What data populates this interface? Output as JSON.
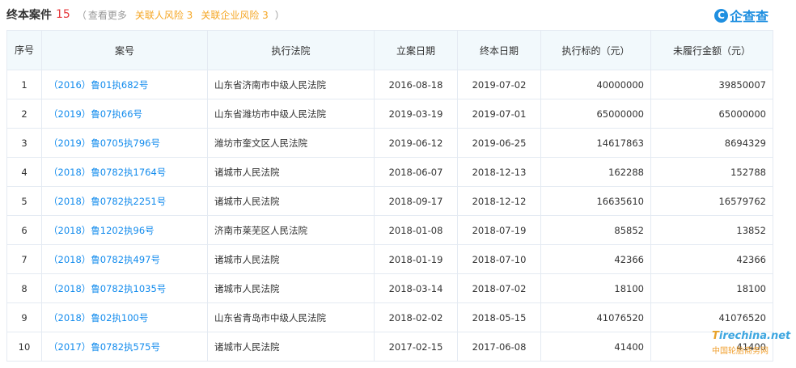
{
  "header": {
    "title": "终本案件",
    "count": "15",
    "paren_open": "（",
    "view_more": "查看更多",
    "related_person_risk": "关联人风险 3",
    "related_company_risk": "关联企业风险 3",
    "paren_close": "）"
  },
  "logo": {
    "mark": "C",
    "text": "企查查"
  },
  "table": {
    "columns": [
      "序号",
      "案号",
      "执行法院",
      "立案日期",
      "终本日期",
      "执行标的（元）",
      "未履行金额（元）"
    ],
    "rows": [
      {
        "idx": "1",
        "case": "（2016）鲁01执682号",
        "court": "山东省济南市中级人民法院",
        "filed": "2016-08-18",
        "closed": "2019-07-02",
        "target": "40000000",
        "unpaid": "39850007"
      },
      {
        "idx": "2",
        "case": "（2019）鲁07执66号",
        "court": "山东省潍坊市中级人民法院",
        "filed": "2019-03-19",
        "closed": "2019-07-01",
        "target": "65000000",
        "unpaid": "65000000"
      },
      {
        "idx": "3",
        "case": "（2019）鲁0705执796号",
        "court": "潍坊市奎文区人民法院",
        "filed": "2019-06-12",
        "closed": "2019-06-25",
        "target": "14617863",
        "unpaid": "8694329"
      },
      {
        "idx": "4",
        "case": "（2018）鲁0782执1764号",
        "court": "诸城市人民法院",
        "filed": "2018-06-07",
        "closed": "2018-12-13",
        "target": "162288",
        "unpaid": "152788"
      },
      {
        "idx": "5",
        "case": "（2018）鲁0782执2251号",
        "court": "诸城市人民法院",
        "filed": "2018-09-17",
        "closed": "2018-12-12",
        "target": "16635610",
        "unpaid": "16579762"
      },
      {
        "idx": "6",
        "case": "（2018）鲁1202执96号",
        "court": "济南市莱芜区人民法院",
        "filed": "2018-01-08",
        "closed": "2018-07-19",
        "target": "85852",
        "unpaid": "13852"
      },
      {
        "idx": "7",
        "case": "（2018）鲁0782执497号",
        "court": "诸城市人民法院",
        "filed": "2018-01-19",
        "closed": "2018-07-10",
        "target": "42366",
        "unpaid": "42366"
      },
      {
        "idx": "8",
        "case": "（2018）鲁0782执1035号",
        "court": "诸城市人民法院",
        "filed": "2018-03-14",
        "closed": "2018-07-02",
        "target": "18100",
        "unpaid": "18100"
      },
      {
        "idx": "9",
        "case": "（2018）鲁02执100号",
        "court": "山东省青岛市中级人民法院",
        "filed": "2018-02-02",
        "closed": "2018-05-15",
        "target": "41076520",
        "unpaid": "41076520"
      },
      {
        "idx": "10",
        "case": "（2017）鲁0782执575号",
        "court": "诸城市人民法院",
        "filed": "2017-02-15",
        "closed": "2017-06-08",
        "target": "41400",
        "unpaid": "41400"
      }
    ]
  },
  "watermark": {
    "brand_t": "T",
    "brand_rest": "irechina.net",
    "subtitle": "中国轮胎商务网"
  }
}
